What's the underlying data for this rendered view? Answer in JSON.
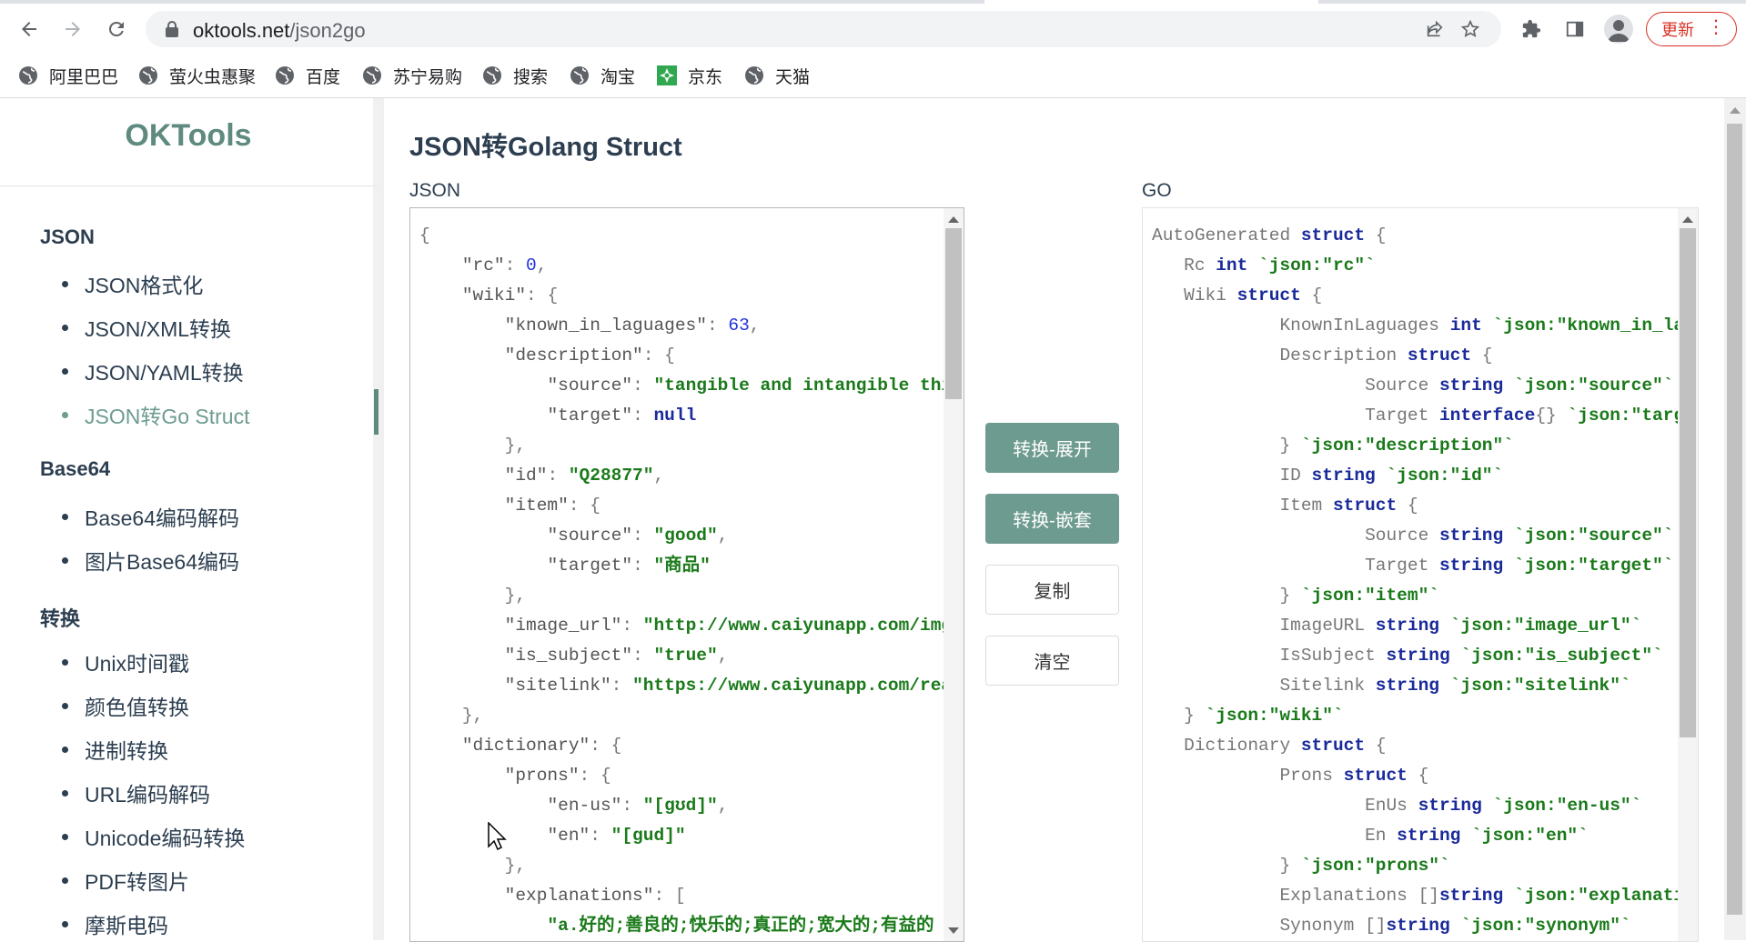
{
  "browser": {
    "url_domain": "oktools.net",
    "url_path": "/json2go",
    "update_label": "更新",
    "bookmarks": [
      "阿里巴巴",
      "萤火虫惠聚",
      "百度",
      "苏宁易购",
      "搜索",
      "淘宝",
      "京东",
      "天猫"
    ]
  },
  "sidebar": {
    "logo": "OKTools",
    "groups": [
      {
        "title": "JSON",
        "items": [
          "JSON格式化",
          "JSON/XML转换",
          "JSON/YAML转换",
          "JSON转Go Struct"
        ]
      },
      {
        "title": "Base64",
        "items": [
          "Base64编码解码",
          "图片Base64编码"
        ]
      },
      {
        "title": "转换",
        "items": [
          "Unix时间戳",
          "颜色值转换",
          "进制转换",
          "URL编码解码",
          "Unicode编码转换",
          "PDF转图片",
          "摩斯电码"
        ]
      }
    ],
    "active_item": "JSON转Go Struct"
  },
  "main": {
    "title": "JSON转Golang Struct",
    "json_label": "JSON",
    "go_label": "GO",
    "buttons": {
      "expand": "转换-展开",
      "nested": "转换-嵌套",
      "copy": "复制",
      "clear": "清空"
    }
  },
  "json_editor_lines": [
    "{",
    "    \"rc\": 0,",
    "    \"wiki\": {",
    "        \"known_in_laguages\": 63,",
    "        \"description\": {",
    "            \"source\": \"tangible and intangible thing,",
    "            \"target\": null",
    "        },",
    "        \"id\": \"Q28877\",",
    "        \"item\": {",
    "            \"source\": \"good\",",
    "            \"target\": \"商品\"",
    "        },",
    "        \"image_url\": \"http://www.caiyunapp.com/imgs/li",
    "        \"is_subject\": \"true\",",
    "        \"sitelink\": \"https://www.caiyunapp.com/read_mo",
    "    },",
    "    \"dictionary\": {",
    "        \"prons\": {",
    "            \"en-us\": \"[gʊd]\",",
    "            \"en\": \"[gud]\"",
    "        },",
    "        \"explanations\": [",
    "            \"a.好的;善良的;快乐的;真正的;宽大的;有益的"
  ],
  "go_editor_lines": [
    "AutoGenerated struct {",
    "   Rc int `json:\"rc\"`",
    "   Wiki struct {",
    "            KnownInLaguages int `json:\"known_in_laguage",
    "            Description struct {",
    "                    Source string `json:\"source\"`",
    "                    Target interface{} `json:\"target\"`",
    "            } `json:\"description\"`",
    "            ID string `json:\"id\"`",
    "            Item struct {",
    "                    Source string `json:\"source\"`",
    "                    Target string `json:\"target\"`",
    "            } `json:\"item\"`",
    "            ImageURL string `json:\"image_url\"`",
    "            IsSubject string `json:\"is_subject\"`",
    "            Sitelink string `json:\"sitelink\"`",
    "   } `json:\"wiki\"`",
    "   Dictionary struct {",
    "            Prons struct {",
    "                    EnUs string `json:\"en-us\"`",
    "                    En string `json:\"en\"`",
    "            } `json:\"prons\"`",
    "            Explanations []string `json:\"explanations\"`",
    "            Synonym []string `json:\"synonym\"`"
  ],
  "colors": {
    "accent": "#6e9b8f",
    "update_red": "#d93025",
    "string_green": "#1a7a1a",
    "keyword_blue": "#1a2a9a",
    "number_blue": "#2233dd"
  },
  "icons": [
    "back-arrow-icon",
    "forward-arrow-icon",
    "reload-icon",
    "lock-icon",
    "share-icon",
    "star-icon",
    "extensions-icon",
    "sidepanel-icon",
    "profile-icon",
    "menu-dots-icon",
    "globe-icon",
    "jd-icon"
  ]
}
